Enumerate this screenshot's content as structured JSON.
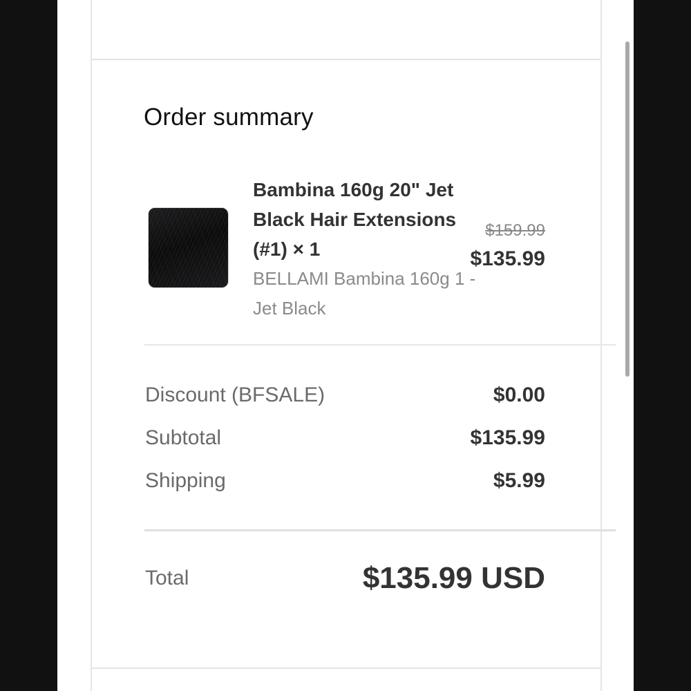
{
  "order_summary": {
    "heading": "Order summary",
    "item": {
      "name": "Bambina 160g 20\" Jet Black Hair Extensions (#1) × 1",
      "variant": "BELLAMI Bambina 160g 1 - Jet Black",
      "original_price": "$159.99",
      "price": "$135.99",
      "image_icon": "hair-extension-thumbnail"
    },
    "lines": [
      {
        "label": "Discount (BFSALE)",
        "value": "$0.00"
      },
      {
        "label": "Subtotal",
        "value": "$135.99"
      },
      {
        "label": "Shipping",
        "value": "$5.99"
      }
    ],
    "total": {
      "label": "Total",
      "value": "$135.99 USD"
    }
  },
  "colors": {
    "background": "#111111",
    "panel": "#ffffff",
    "text_primary": "#333333",
    "text_secondary": "#6a6a6a",
    "text_muted": "#8a8a8a",
    "divider": "#e6e6e6"
  }
}
